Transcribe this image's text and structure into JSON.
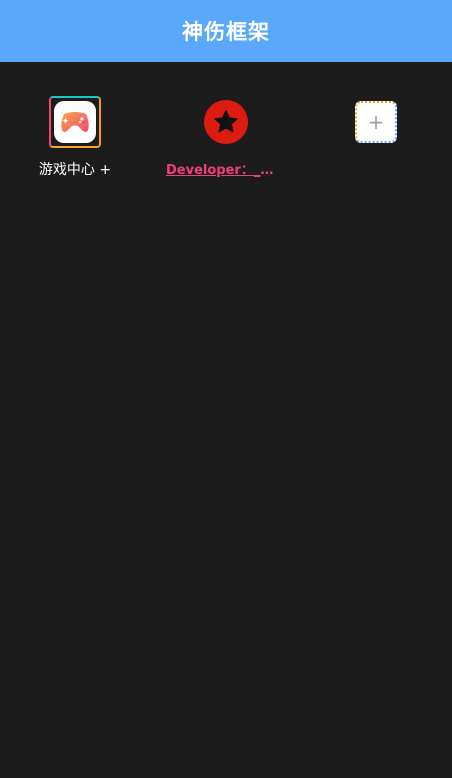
{
  "header": {
    "title": "神伤框架"
  },
  "tiles": [
    {
      "label": "游戏中心 +",
      "icon": "gamepad-icon"
    },
    {
      "label": "Developer：_Mr...",
      "icon": "star-icon"
    },
    {
      "label": "",
      "icon": "add-icon",
      "glyph": "+"
    }
  ],
  "colors": {
    "header_bg": "#5aa8fc",
    "background": "#1c1c1c",
    "developer_link": "#ee3f77",
    "star_circle": "#dd1b0f"
  }
}
